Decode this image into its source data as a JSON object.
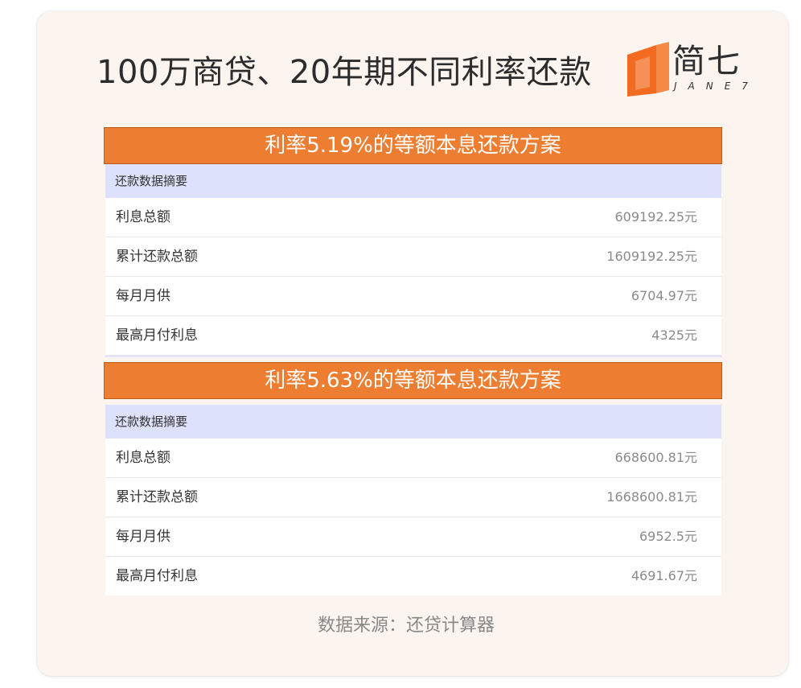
{
  "title": "100万商贷、20年期不同利率还款",
  "logo": {
    "cn": "简七",
    "en": "JANE7",
    "colors": {
      "orange": "#f26b21",
      "dark": "#2f2f2f"
    }
  },
  "colors": {
    "header_bg": "#ed7d31",
    "summary_bg": "#dde1fb",
    "card_bg": "#fcf5ef"
  },
  "sections": [
    {
      "header": "利率5.19%的等额本息还款方案",
      "summary": "还款数据摘要",
      "rows": [
        {
          "label": "利息总额",
          "value": "609192.25元"
        },
        {
          "label": "累计还款总额",
          "value": "1609192.25元"
        },
        {
          "label": "每月月供",
          "value": "6704.97元"
        },
        {
          "label": "最高月付利息",
          "value": "4325元"
        }
      ]
    },
    {
      "header": "利率5.63%的等额本息还款方案",
      "summary": "还款数据摘要",
      "rows": [
        {
          "label": "利息总额",
          "value": "668600.81元"
        },
        {
          "label": "累计还款总额",
          "value": "1668600.81元"
        },
        {
          "label": "每月月供",
          "value": "6952.5元"
        },
        {
          "label": "最高月付利息",
          "value": "4691.67元"
        }
      ]
    }
  ],
  "footer": "数据来源：还贷计算器"
}
